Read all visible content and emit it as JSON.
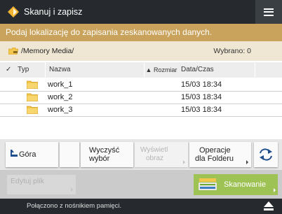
{
  "header": {
    "title": "Skanuj i zapisz",
    "app_icon": "diamond-arrow-icon",
    "menu_icon": "hamburger-menu-icon"
  },
  "banner": {
    "text": "Podaj lokalizację do zapisania zeskanowanych danych."
  },
  "path_bar": {
    "path": "/Memory Media/",
    "choice_label": "Wybrano: 0"
  },
  "table": {
    "columns": {
      "type": "Typ",
      "name": "Nazwa",
      "sort": "▲ Rozmiar",
      "date": "Data/Czas"
    },
    "rows": [
      {
        "name": "work_1",
        "date": "15/03 18:34"
      },
      {
        "name": "work_2",
        "date": "15/03 18:34"
      },
      {
        "name": "work_3",
        "date": "15/03 18:34"
      }
    ]
  },
  "buttons": {
    "up": "Góra",
    "clear_line1": "Wyczyść",
    "clear_line2": "wybór",
    "show_line1": "Wyświetl",
    "show_line2": "obraz",
    "ops_line1": "Operacje",
    "ops_line2": "dla Folderu",
    "edit_file": "Edytuj plik",
    "scan": "Skanowanie"
  },
  "status": {
    "message": "Połączono z nośnikiem pamięci."
  },
  "colors": {
    "titlebar": "#262a2e",
    "banner": "#c9a35c",
    "path_bar": "#efe7d3",
    "folder": "#f2c64a",
    "scan_button": "#9fc255",
    "accent_blue": "#1f4e8c"
  }
}
